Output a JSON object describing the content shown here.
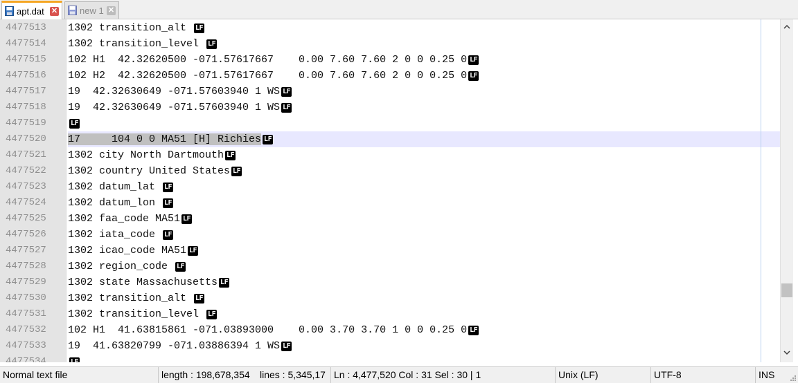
{
  "tabs": [
    {
      "label": "apt.dat",
      "state": "active",
      "icon": "save-disk-icon"
    },
    {
      "label": "new 1",
      "state": "inactive",
      "icon": "save-disk-icon"
    }
  ],
  "editor": {
    "current_line_index": 7,
    "lines": [
      {
        "num": "4477513",
        "text": "1302 transition_alt ",
        "lf": true
      },
      {
        "num": "4477514",
        "text": "1302 transition_level ",
        "lf": true
      },
      {
        "num": "4477515",
        "text": "102 H1  42.32620500 -071.57617667    0.00 7.60 7.60 2 0 0 0.25 0",
        "lf": true
      },
      {
        "num": "4477516",
        "text": "102 H2  42.32620500 -071.57617667    0.00 7.60 7.60 2 0 0 0.25 0",
        "lf": true
      },
      {
        "num": "4477517",
        "text": "19  42.32630649 -071.57603940 1 WS",
        "lf": true
      },
      {
        "num": "4477518",
        "text": "19  42.32630649 -071.57603940 1 WS",
        "lf": true
      },
      {
        "num": "4477519",
        "text": "",
        "lf": true
      },
      {
        "num": "4477520",
        "text": "17     104 0 0 MA51 [H] Richies",
        "lf": true,
        "selected_text": "17     104 0 0 MA51 [H] Richies"
      },
      {
        "num": "4477521",
        "text": "1302 city North Dartmouth",
        "lf": true
      },
      {
        "num": "4477522",
        "text": "1302 country United States",
        "lf": true
      },
      {
        "num": "4477523",
        "text": "1302 datum_lat ",
        "lf": true
      },
      {
        "num": "4477524",
        "text": "1302 datum_lon ",
        "lf": true
      },
      {
        "num": "4477525",
        "text": "1302 faa_code MA51",
        "lf": true
      },
      {
        "num": "4477526",
        "text": "1302 iata_code ",
        "lf": true
      },
      {
        "num": "4477527",
        "text": "1302 icao_code MA51",
        "lf": true
      },
      {
        "num": "4477528",
        "text": "1302 region_code ",
        "lf": true
      },
      {
        "num": "4477529",
        "text": "1302 state Massachusetts",
        "lf": true
      },
      {
        "num": "4477530",
        "text": "1302 transition_alt ",
        "lf": true
      },
      {
        "num": "4477531",
        "text": "1302 transition_level ",
        "lf": true
      },
      {
        "num": "4477532",
        "text": "102 H1  41.63815861 -071.03893000    0.00 3.70 3.70 1 0 0 0.25 0",
        "lf": true
      },
      {
        "num": "4477533",
        "text": "19  41.63820799 -071.03886394 1 WS",
        "lf": true
      },
      {
        "num": "4477534",
        "text": "",
        "lf": true
      }
    ],
    "eol_marker": "LF"
  },
  "statusbar": {
    "file_type": "Normal text file",
    "length": "length : 198,678,354",
    "lines": "lines : 5,345,17",
    "position": "Ln : 4,477,520    Col : 31    Sel : 30 | 1",
    "eol": "Unix (LF)",
    "encoding": "UTF-8",
    "mode": "INS"
  },
  "scrollbar": {
    "position_fraction": 0.84
  },
  "colors": {
    "current_line": "#e8e8ff",
    "selection": "#c0c0c0",
    "gutter": "#e4e4e4",
    "line_number": "#8f8f8f",
    "active_tab_accent": "#f5a623",
    "close_button": "#d9534f"
  }
}
